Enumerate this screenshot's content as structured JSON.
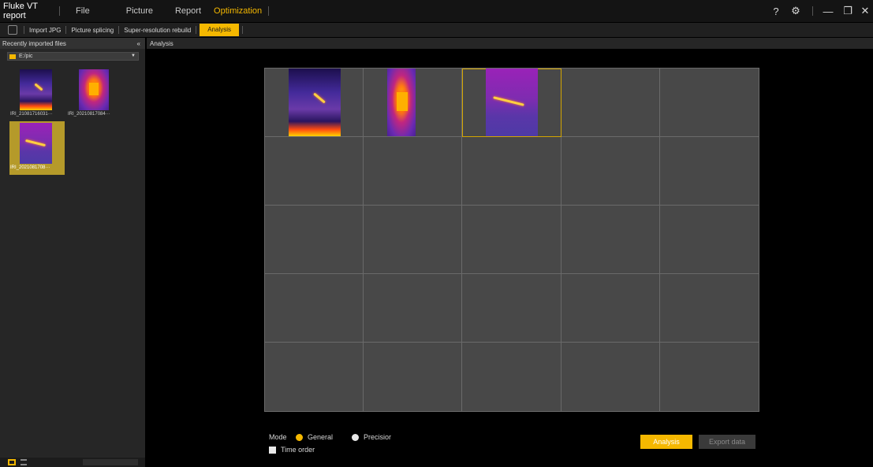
{
  "app": {
    "title": "Fluke VT report",
    "menu": [
      "File",
      "Picture",
      "Report",
      "Optimization"
    ],
    "active_menu": "Optimization"
  },
  "window_controls": {
    "help": "?",
    "settings": "⚙",
    "minimize": "—",
    "restore": "❐",
    "close": "✕"
  },
  "toolbar": {
    "items": [
      "Import JPG",
      "Picture splicing",
      "Super-resolution rebuild",
      "Analysis"
    ],
    "active": "Analysis"
  },
  "left_panel": {
    "header": "Recently imported files",
    "collapse_icon": "«",
    "path": "E:/pic",
    "files": [
      {
        "name": "IRI_21081716031···",
        "thumb": "thermal-a",
        "selected": false
      },
      {
        "name": "IRI_20210817084···",
        "thumb": "thermal-b",
        "selected": false
      },
      {
        "name": "IRI_2021081708···",
        "thumb": "thermal-c",
        "selected": true
      }
    ]
  },
  "main": {
    "header": "Analysis",
    "grid": {
      "rows": 5,
      "cols": 5
    },
    "slots": [
      {
        "thumb": "thermal-a",
        "selected": false
      },
      {
        "thumb": "thermal-b",
        "selected": false
      },
      {
        "thumb": "thermal-c",
        "selected": true
      }
    ]
  },
  "controls": {
    "mode_label": "Mode",
    "mode_options": [
      "General",
      "Precisior"
    ],
    "mode_selected": "General",
    "time_order_label": "Time order",
    "time_order_checked": false,
    "analysis_button": "Analysis",
    "export_button": "Export data"
  },
  "colors": {
    "accent": "#f5b800",
    "background": "#000000",
    "panel": "#262626",
    "grid_cell": "#484848"
  }
}
